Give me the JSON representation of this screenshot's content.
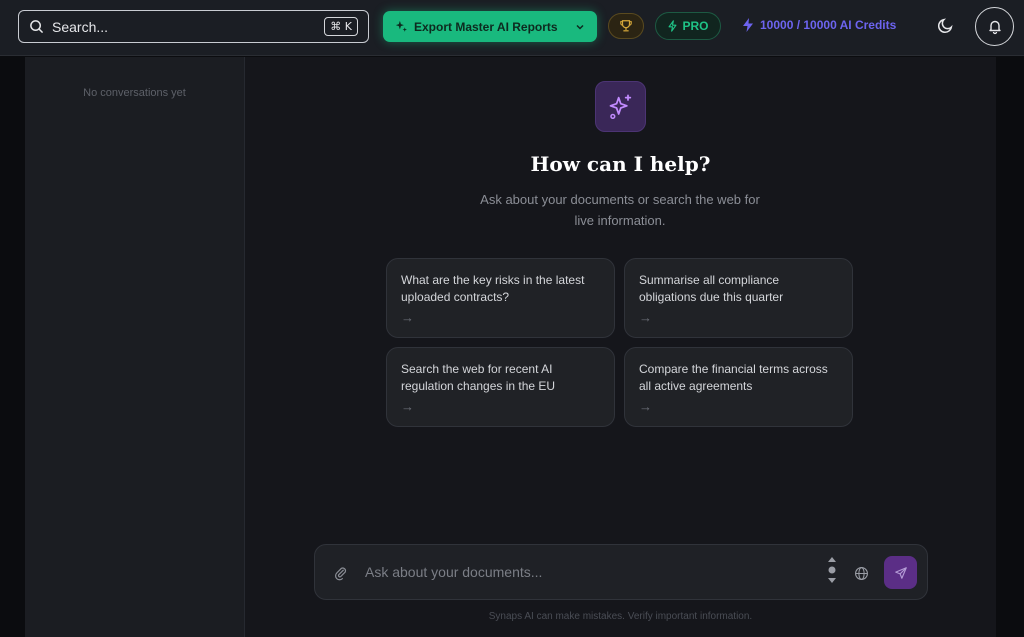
{
  "topbar": {
    "search_label": "Search...",
    "search_shortcut": "⌘ K",
    "export_label": "Export Master AI Reports",
    "pro_label": "PRO",
    "credits_label": "10000 / 10000 AI Credits",
    "icons": [
      "search-icon",
      "sparkle-icon",
      "chevron-down-icon",
      "trophy-icon",
      "bolt-icon",
      "moon-icon",
      "bell-icon"
    ],
    "colors": {
      "export_bg": "#19b97e",
      "pro_text": "#1fc387",
      "credits_text": "#6d64f0"
    }
  },
  "sidebar": {
    "empty_text": "No conversations yet"
  },
  "main": {
    "headline": "How can I help?",
    "subtitle": "Ask about your documents or search the web for live information.",
    "suggestions": [
      {
        "text": "What are the key risks in the latest uploaded contracts?",
        "arrow": "→"
      },
      {
        "text": "Summarise all compliance obligations due this quarter",
        "arrow": "→"
      },
      {
        "text": "Search the web for recent AI regulation changes in the EU",
        "arrow": "→"
      },
      {
        "text": "Compare the financial terms across all active agreements",
        "arrow": "→"
      }
    ],
    "composer": {
      "placeholder": "Ask about your documents..."
    },
    "disclaimer": "Synaps AI can make mistakes. Verify important information."
  }
}
